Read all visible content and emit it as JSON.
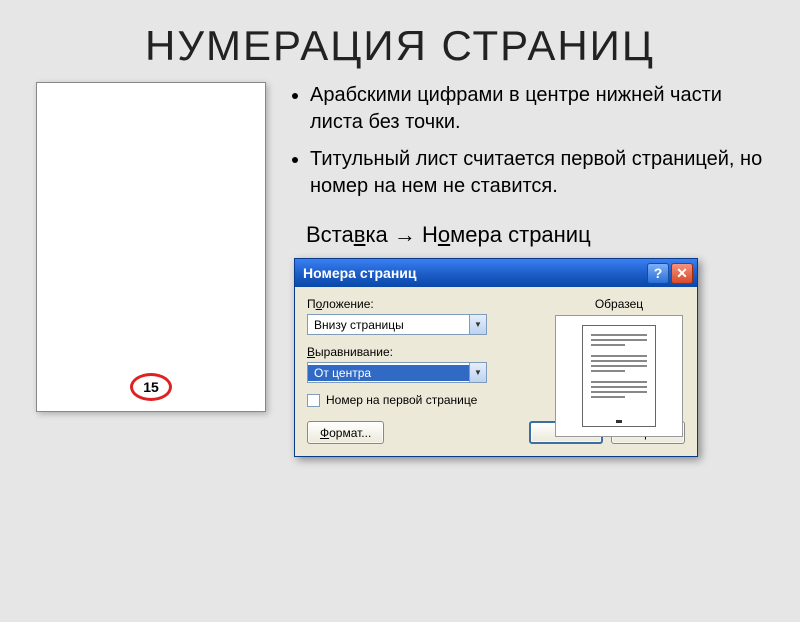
{
  "slide": {
    "title": "НУМЕРАЦИЯ СТРАНИЦ",
    "page_number": "15",
    "bullets": [
      "Арабскими цифрами в центре нижней части листа без точки.",
      "Титульный лист считается первой страницей, но номер на нем не ставится."
    ],
    "menu_path": {
      "item1_pre": "Вста",
      "item1_u": "в",
      "item1_post": "ка",
      "arrow": "→",
      "item2_pre": "Н",
      "item2_u": "о",
      "item2_post": "мера страниц"
    }
  },
  "dialog": {
    "title": "Номера страниц",
    "help": "?",
    "close": "✕",
    "position": {
      "label_pre": "П",
      "label_u": "о",
      "label_post": "ложение:",
      "value": "Внизу страницы"
    },
    "alignment": {
      "label_pre": "",
      "label_u": "В",
      "label_post": "ыравнивание:",
      "value": "От центра"
    },
    "first_page": {
      "label_pre": "",
      "label_u": "Н",
      "label_post": "омер на первой странице",
      "checked": false
    },
    "sample_label": "Образец",
    "buttons": {
      "format_pre": "",
      "format_u": "Ф",
      "format_post": "ормат...",
      "ok": "ОК",
      "close": "Закрыть"
    }
  }
}
